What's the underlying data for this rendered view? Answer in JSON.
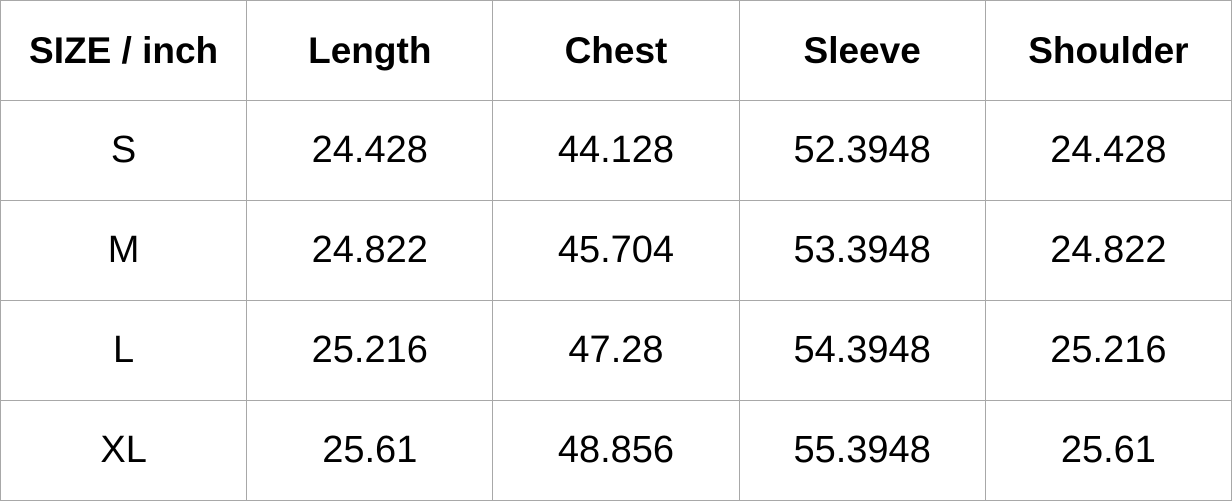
{
  "size_chart": {
    "headers": [
      "SIZE / inch",
      "Length",
      "Chest",
      "Sleeve",
      "Shoulder"
    ],
    "rows": [
      [
        "S",
        "24.428",
        "44.128",
        "52.3948",
        "24.428"
      ],
      [
        "M",
        "24.822",
        "45.704",
        "53.3948",
        "24.822"
      ],
      [
        "L",
        "25.216",
        "47.28",
        "54.3948",
        "25.216"
      ],
      [
        "XL",
        "25.61",
        "48.856",
        "55.3948",
        "25.61"
      ]
    ]
  }
}
